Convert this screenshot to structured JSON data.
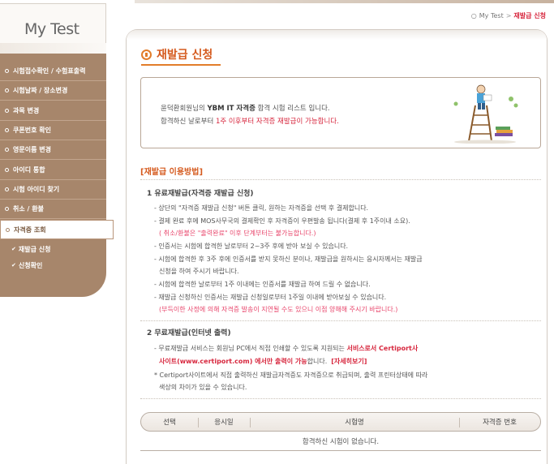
{
  "sidebar": {
    "logo": "My Test",
    "items": [
      {
        "label": "시험접수확인 / 수험표출력"
      },
      {
        "label": "시험날짜 / 장소변경"
      },
      {
        "label": "과목 변경"
      },
      {
        "label": "쿠폰번호 확인"
      },
      {
        "label": "영문이름 변경"
      },
      {
        "label": "아이디 통합"
      },
      {
        "label": "시험 아이디 찾기"
      },
      {
        "label": "취소 / 환불"
      },
      {
        "label": "자격증 조회"
      }
    ],
    "subitems": [
      {
        "label": "재발급 신청"
      },
      {
        "label": "신청확인"
      }
    ]
  },
  "breadcrumb": {
    "root": "My Test",
    "sep": ">",
    "current": "재발급 신청"
  },
  "page_title": "재발급 신청",
  "info": {
    "user_name": "윤덕환",
    "line1_a": "회원님의 ",
    "line1_b": "YBM IT 자격증",
    "line1_c": " 합격 시험 리스트 입니다.",
    "line2_a": "합격하신 날로부터 ",
    "line2_b": "1주 이후부터 자격증 재발급이 가능합니다."
  },
  "guide_title": "[재발급 이용방법]",
  "paid": {
    "head": "1  유료재발급(자격증 재발급 신청)",
    "lines": [
      "- 상단의 \"자격증 재발급 신청\" 버튼 클릭, 원하는 자격증을 선택 후 결제합니다.",
      "- 결제 완료 후에 MOS사무국의 결제확인 후 자격증이 우편발송 됩니다(결제 후 1주이내 소요).",
      "( 취소/환불은 \"출력완료\" 이후 단계부터는 불가능합니다.)",
      "- 인증서는 시험에 합격한 날로부터 2~3주 후에 받아 보실 수 있습니다.",
      "- 시험에 합격한 후 3주 후에 인증서를 받지 못하신 분이나, 재발급을 원하시는 응시자께서는 재발급",
      "신청을 하여 주시기 바랍니다.",
      "- 시험에 합격한 날로부터 1주 이내에는 인증서를 재발급 하여 드릴 수 없습니다.",
      "- 재발급 신청하신 인증서는 재발급 신청일로부터 1주일 이내에 받아보실 수 있습니다.",
      "(부득이한 사정에 의해 자격증 발송이 지연될 수도 있으니 이점 양해해 주시기 바랍니다.)"
    ]
  },
  "free": {
    "head": "2  무료재발급(인터넷 출력)",
    "line1_a": "- 무료재발급 서비스는 회원님 PC에서 직접 인쇄할 수 있도록 지원되는 ",
    "line1_b": "서비스로서 Certiport사",
    "line2_a": "사이트(www.certiport.com) 에서만 출력이 가능",
    "line2_b": "합니다.",
    "detail_link": "[자세히보기]",
    "line3": "* Certiport사이트에서 직접 출력하신 재발급자격증도 자격증으로 취급되며, 출력 프린터상태에 따라",
    "line4": "색상의 차이가 있을 수 있습니다."
  },
  "table": {
    "columns": [
      "선택",
      "응시일",
      "시험명",
      "자격증 번호"
    ],
    "empty": "합격하신 시험이 없습니다."
  }
}
